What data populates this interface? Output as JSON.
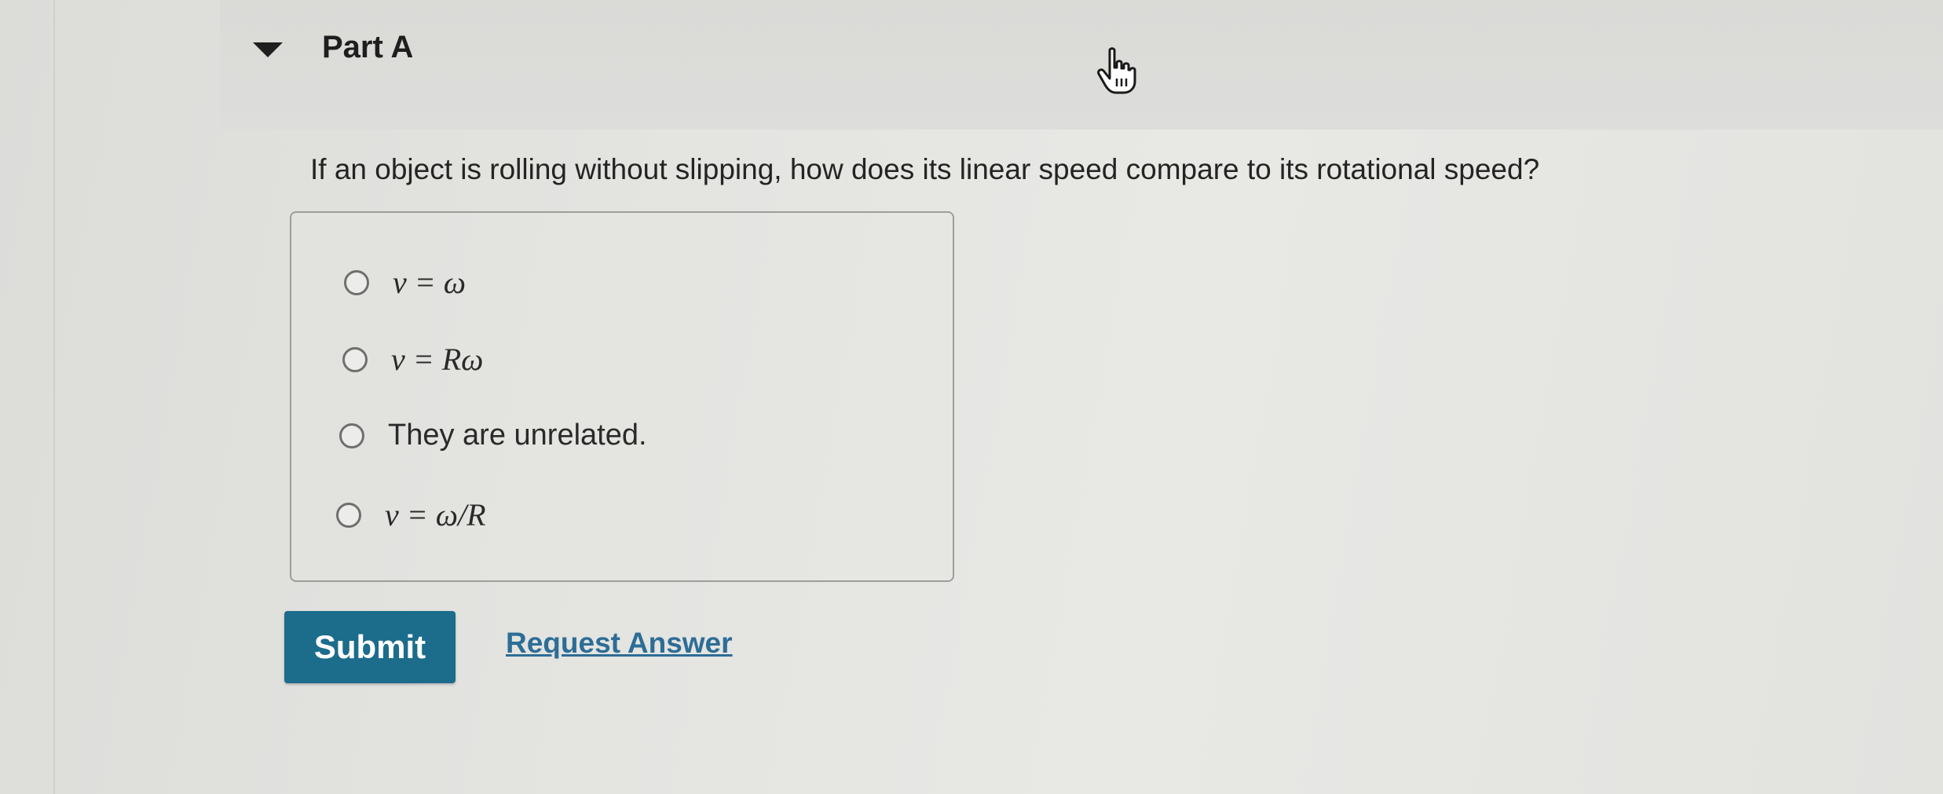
{
  "part": {
    "title": "Part A"
  },
  "question": {
    "text": "If an object is rolling without slipping, how does its linear speed compare to its rotational speed?"
  },
  "options": [
    {
      "label": "v = ω",
      "selected": false
    },
    {
      "label": "v = Rω",
      "selected": false
    },
    {
      "label": "They are unrelated.",
      "selected": false
    },
    {
      "label": "v = ω/R",
      "selected": false
    }
  ],
  "actions": {
    "submit_label": "Submit",
    "request_answer_label": "Request Answer"
  },
  "colors": {
    "submit_bg": "#1c6c8b",
    "link": "#2d6d96"
  },
  "icons": {
    "toggle": "caret-down-icon",
    "cursor": "hand-pointer-icon",
    "radio": "radio-unchecked-icon"
  }
}
